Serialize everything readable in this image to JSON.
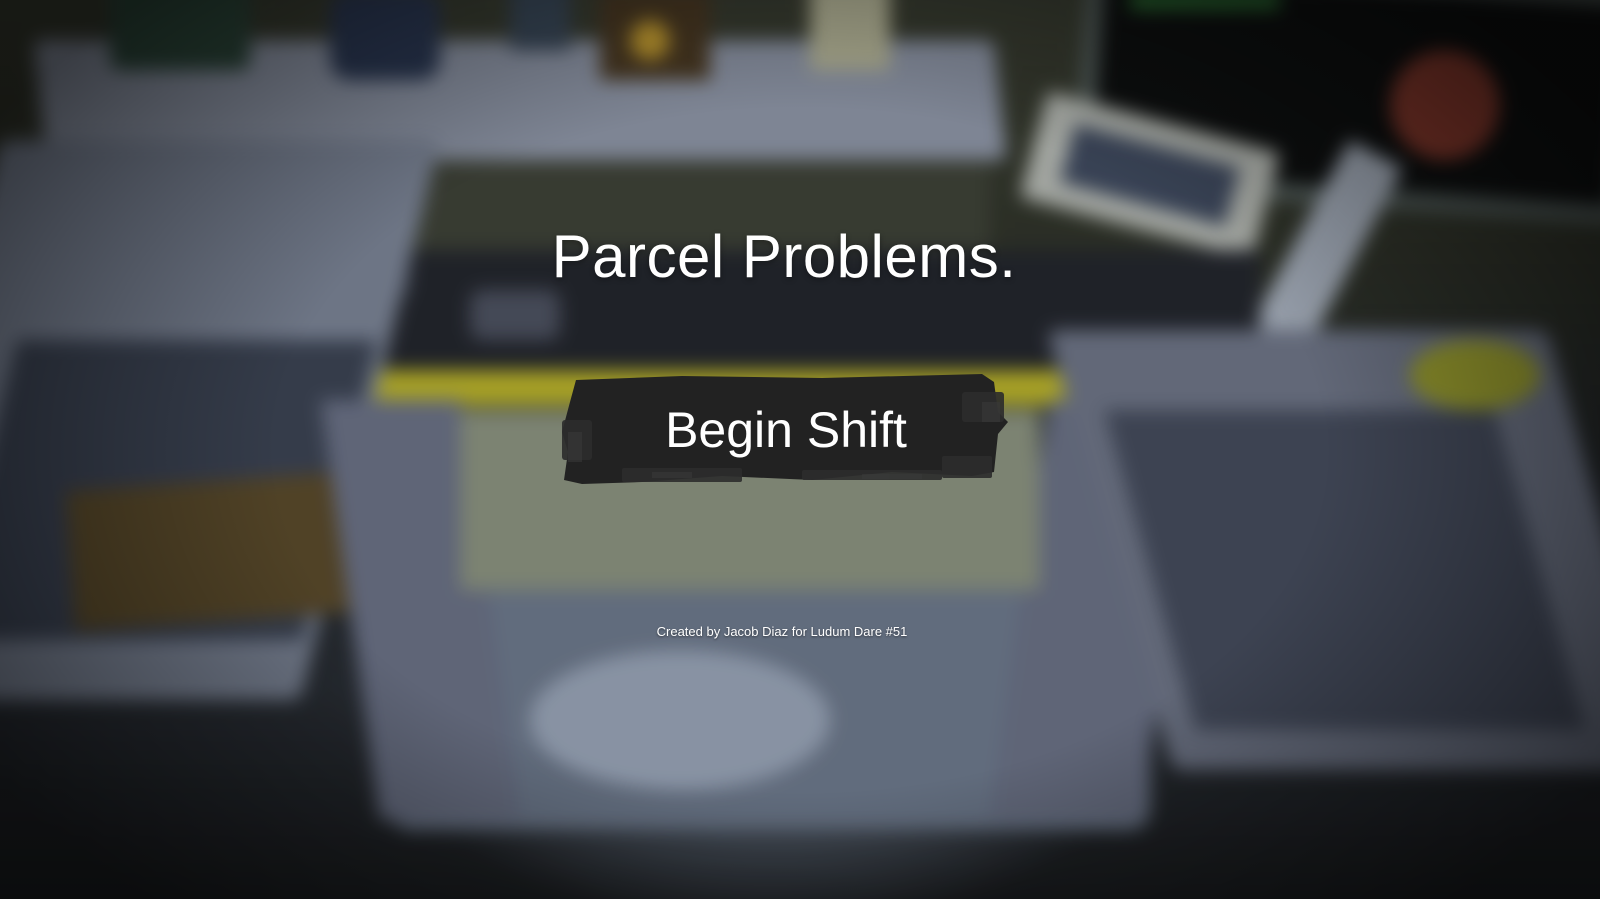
{
  "game": {
    "title": "Parcel Problems.",
    "begin_button_label": "Begin Shift",
    "credit": "Created by Jacob Diaz for Ludum Dare #51"
  },
  "colors": {
    "text": "#ffffff",
    "button_brush": "#222222",
    "belt_stripe": "#bcb52a"
  },
  "background": {
    "description_icon": "blurred-mailroom-scene"
  }
}
